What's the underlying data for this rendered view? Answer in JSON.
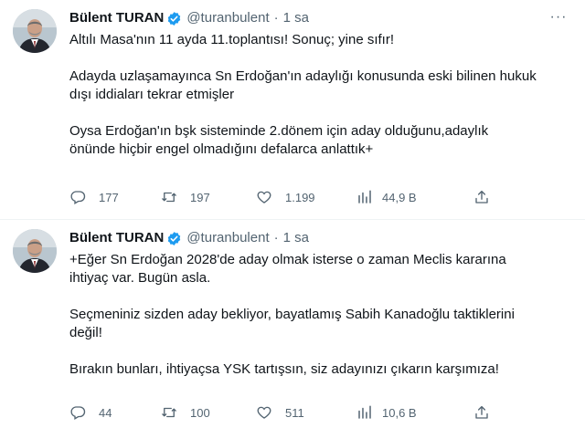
{
  "tweets": [
    {
      "author_name": "Bülent TURAN",
      "handle": "@turanbulent",
      "separator": "·",
      "time": "1 sa",
      "more": "···",
      "text": "Altılı Masa'nın 11 ayda 11.toplantısı! Sonuç; yine sıfır!\n\nAdayda uzlaşamayınca Sn Erdoğan'ın adaylığı konusunda eski bilinen hukuk\ndışı iddiaları tekrar etmişler\n\nOysa Erdoğan'ın bşk sisteminde 2.dönem için aday olduğunu,adaylık\nönünde hiçbir engel olmadığını defalarca anlattık+",
      "replies": "177",
      "retweets": "197",
      "likes": "1.199",
      "views": "44,9 B"
    },
    {
      "author_name": "Bülent TURAN",
      "handle": "@turanbulent",
      "separator": "·",
      "time": "1 sa",
      "more": "···",
      "text": "+Eğer Sn Erdoğan 2028'de aday olmak isterse o zaman Meclis kararına\nihtiyaç var. Bugün asla.\n\nSeçmeniniz sizden aday bekliyor, bayatlamış Sabih Kanadoğlu taktiklerini\ndeğil!\n\nBırakın bunları, ihtiyaçsa YSK tartışsın, siz adayınızı çıkarın karşımıza!",
      "replies": "44",
      "retweets": "100",
      "likes": "511",
      "views": "10,6 B"
    }
  ],
  "icons": {
    "verified": "verified-badge-icon",
    "reply": "reply-icon",
    "retweet": "retweet-icon",
    "like": "heart-icon",
    "views": "views-icon",
    "share": "share-icon",
    "more": "more-icon"
  },
  "colors": {
    "text": "#0f1419",
    "secondary": "#536471",
    "verified": "#1d9bf0",
    "divider": "#eff3f4"
  }
}
